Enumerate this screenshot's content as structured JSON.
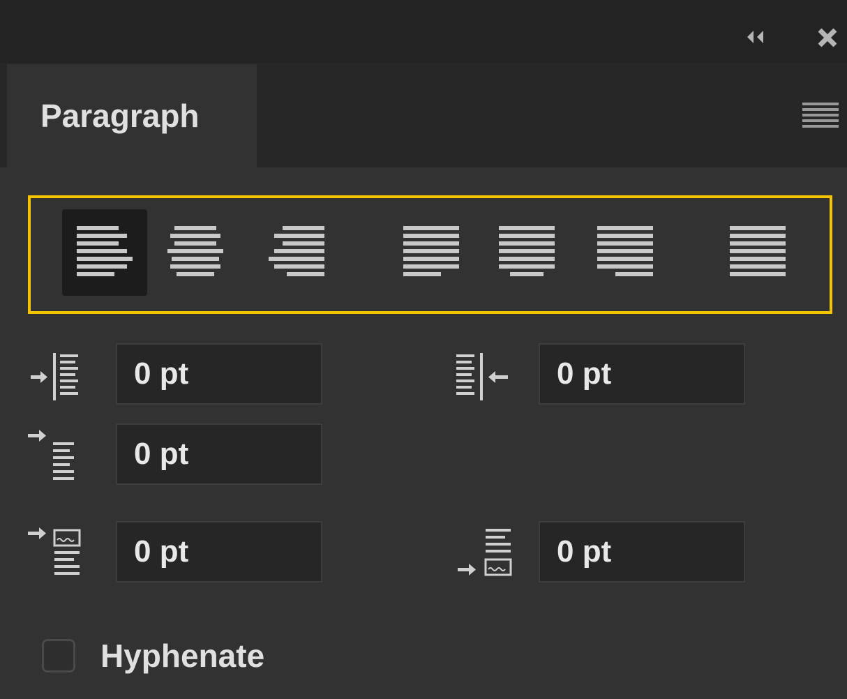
{
  "window": {
    "collapse_icon": "double-chevron-left-icon",
    "close_icon": "close-icon"
  },
  "tab": {
    "label": "Paragraph"
  },
  "panel_menu_icon": "hamburger-menu-icon",
  "alignment": {
    "selected": "align-left",
    "buttons": [
      "align-left",
      "align-center",
      "align-right",
      "justify-last-left",
      "justify-last-center",
      "justify-last-right",
      "justify-all"
    ]
  },
  "fields": {
    "left_indent": "0 pt",
    "right_indent": "0 pt",
    "first_line_indent": "0 pt",
    "space_before": "0 pt",
    "space_after": "0 pt"
  },
  "hyphenate": {
    "label": "Hyphenate",
    "checked": false
  },
  "colors": {
    "accent_highlight": "#f5c300",
    "panel_bg": "#323232",
    "field_bg": "#262626",
    "text": "#e0e0e0"
  }
}
